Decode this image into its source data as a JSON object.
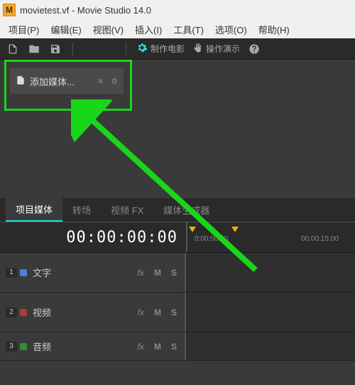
{
  "window": {
    "title": "movietest.vf - Movie Studio 14.0",
    "logo_letter": "M"
  },
  "menu": {
    "project": "项目(P)",
    "edit": "编辑(E)",
    "view": "视图(V)",
    "insert": "插入(I)",
    "tools": "工具(T)",
    "options": "选项(O)",
    "help": "帮助(H)"
  },
  "toolbar": {
    "make_movie": "制作电影",
    "demo": "操作演示"
  },
  "media": {
    "add_media_label": "添加媒体..."
  },
  "tabs": {
    "project_media": "项目媒体",
    "transitions": "转场",
    "video_fx": "视频 FX",
    "media_generators": "媒体生成器"
  },
  "timecode": "00:00:00:00",
  "ruler": {
    "t0": "0:00:00:00",
    "t1": "00:00:15:00"
  },
  "tracks": [
    {
      "num": "1",
      "color": "#4a7fd6",
      "name": "文字"
    },
    {
      "num": "2",
      "color": "#b03a3a",
      "name": "视频"
    },
    {
      "num": "3",
      "color": "#3a8a3a",
      "name": "音频"
    }
  ],
  "track_ctl": {
    "fx": "fx",
    "m": "M",
    "s": "S"
  }
}
